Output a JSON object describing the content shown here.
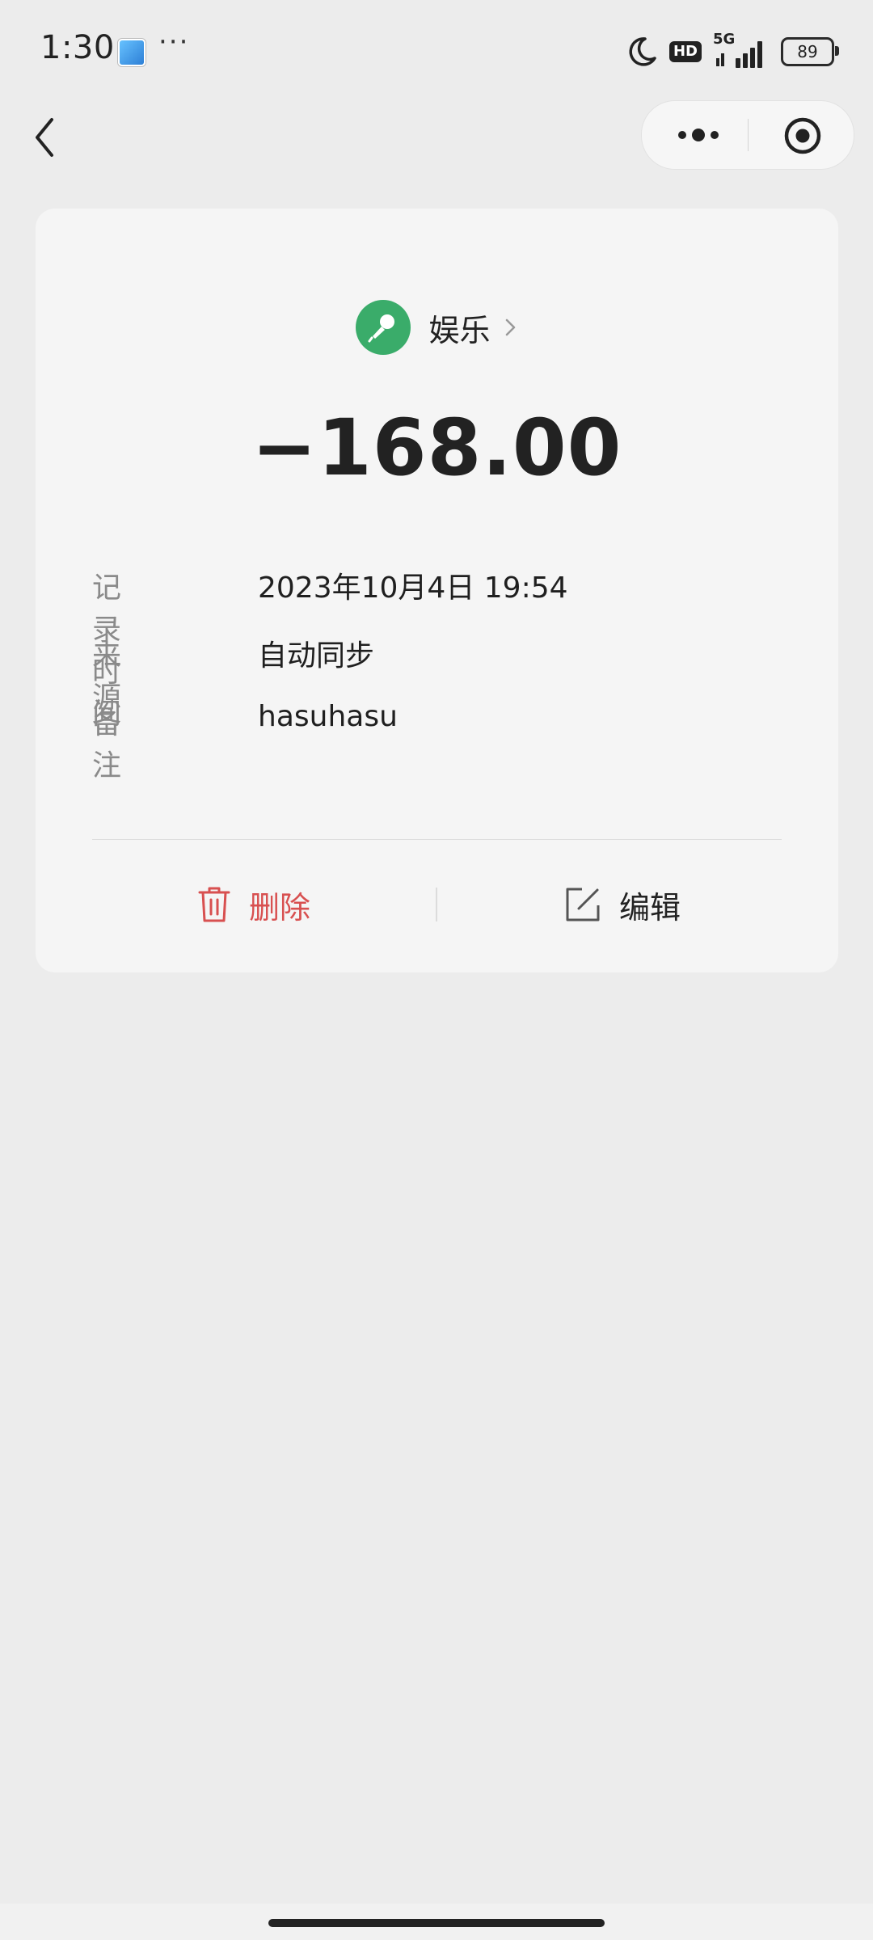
{
  "status_bar": {
    "time": "1:30",
    "more": "···",
    "hd_badge": "HD",
    "network": "5G",
    "battery": "89",
    "icons": [
      "app-notification-icon",
      "moon-icon",
      "hd-icon",
      "signal-icon",
      "battery-icon"
    ]
  },
  "nav": {
    "icons": [
      "back-icon",
      "more-dots-icon",
      "close-target-icon"
    ]
  },
  "record": {
    "category": "娱乐",
    "category_icon": "microphone-icon",
    "category_color": "#3aac6a",
    "amount": "−168.00",
    "fields": [
      {
        "label": "记录时间",
        "value": "2023年10月4日 19:54"
      },
      {
        "label": "来源",
        "value": "自动同步"
      },
      {
        "label": "备注",
        "value": "hasuhasu"
      }
    ]
  },
  "actions": {
    "delete_label": "删除",
    "edit_label": "编辑",
    "delete_color": "#d85050"
  }
}
